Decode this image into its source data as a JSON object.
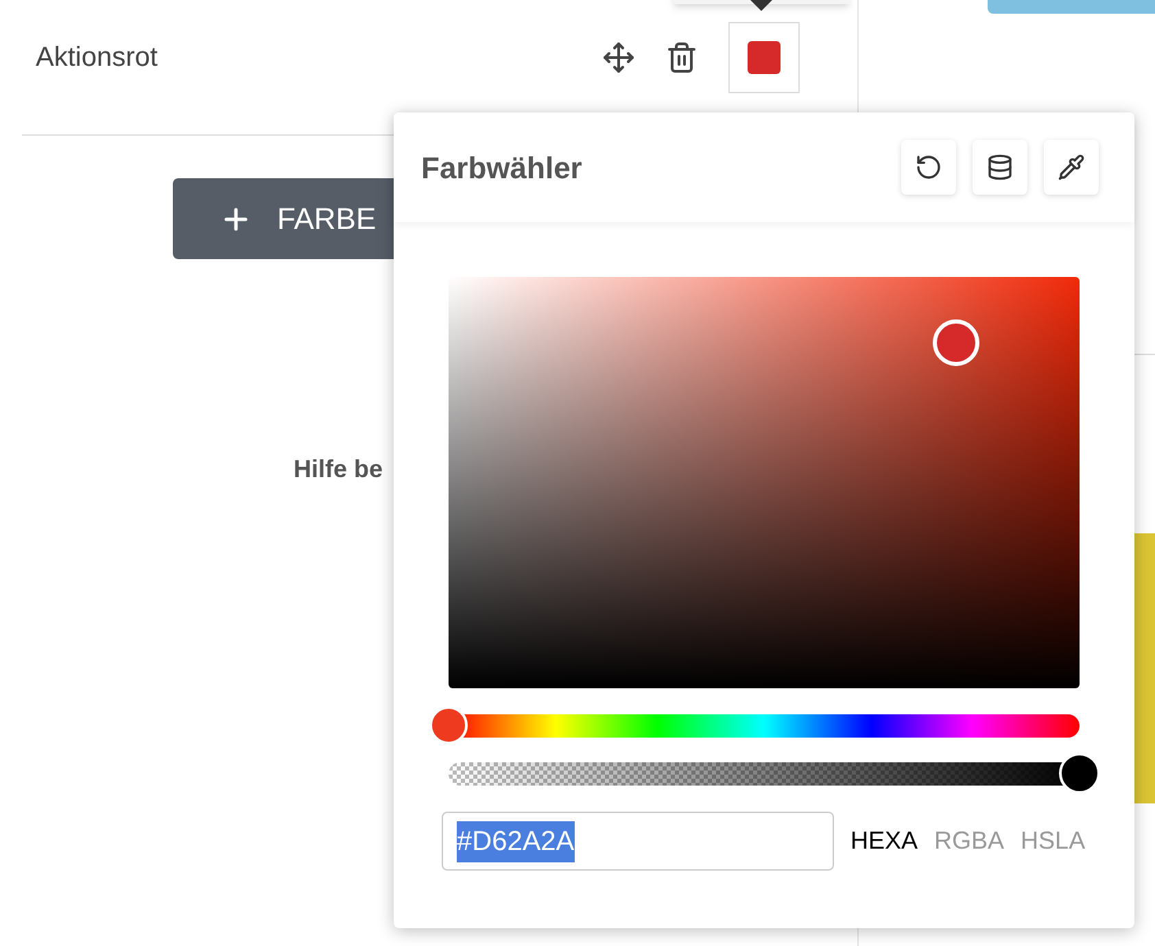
{
  "color_row": {
    "name": "Aktionsrot"
  },
  "add_button": {
    "label": "FARBE"
  },
  "help_text": "Hilfe be",
  "color_picker": {
    "title": "Farbwähler",
    "value": "#D62A2A",
    "hue": {
      "level": 0
    },
    "alpha": {
      "level": 1
    },
    "formats": [
      {
        "label": "HEXA",
        "selected": true
      },
      {
        "label": "RGBA",
        "selected": false
      },
      {
        "label": "HSLA",
        "selected": false
      }
    ]
  }
}
